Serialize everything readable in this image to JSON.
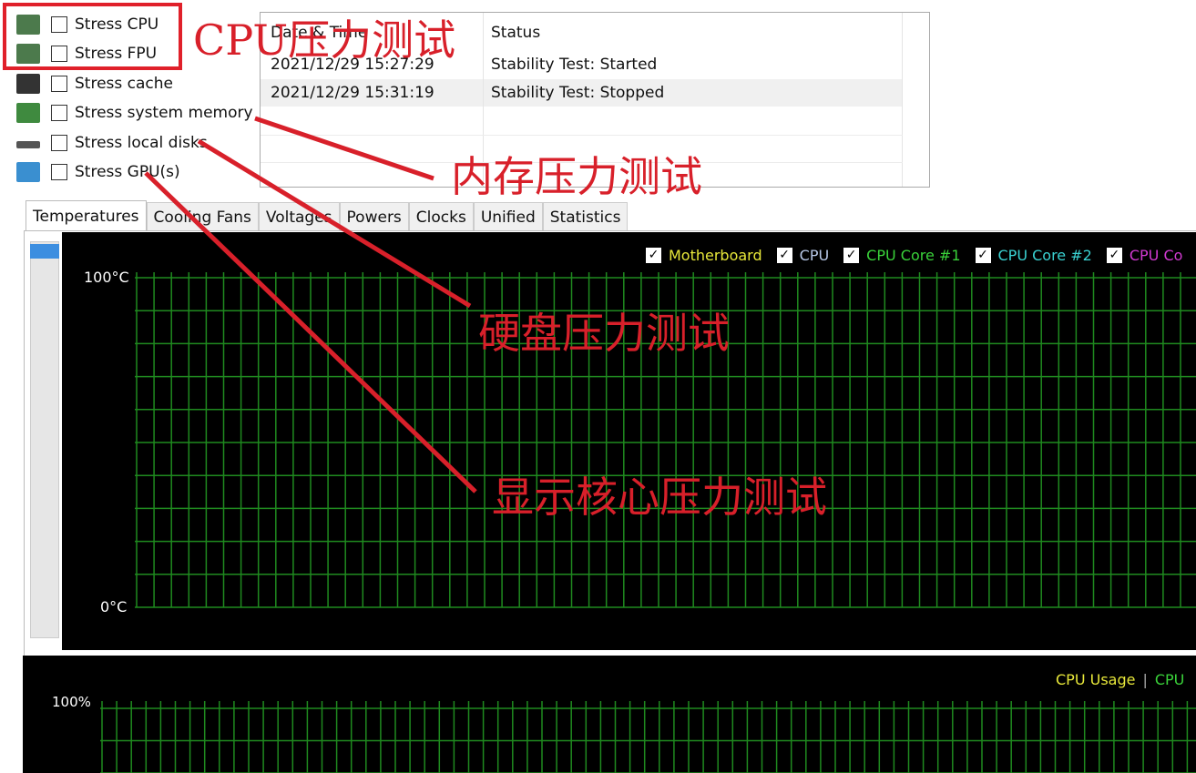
{
  "options": [
    {
      "label": "Stress CPU",
      "icon": "cpu-chip-icon",
      "checked": false
    },
    {
      "label": "Stress FPU",
      "icon": "fpu-chip-icon",
      "checked": false
    },
    {
      "label": "Stress cache",
      "icon": "cache-chip-icon",
      "checked": false
    },
    {
      "label": "Stress system memory",
      "icon": "memory-module-icon",
      "checked": false
    },
    {
      "label": "Stress local disks",
      "icon": "disk-drive-icon",
      "checked": false
    },
    {
      "label": "Stress GPU(s)",
      "icon": "gpu-card-icon",
      "checked": false
    }
  ],
  "log": {
    "headers": [
      "Date & Time",
      "Status"
    ],
    "rows": [
      [
        "2021/12/29 15:27:29",
        "Stability Test: Started"
      ],
      [
        "2021/12/29 15:31:19",
        "Stability Test: Stopped"
      ]
    ]
  },
  "tabs": [
    "Temperatures",
    "Cooling Fans",
    "Voltages",
    "Powers",
    "Clocks",
    "Unified",
    "Statistics"
  ],
  "active_tab": "Temperatures",
  "temp_chart": {
    "ymax_label": "100°C",
    "ymin_label": "0°C",
    "legend": [
      {
        "label": "Motherboard",
        "color": "#e8e83a"
      },
      {
        "label": "CPU",
        "color": "#b8c8e8"
      },
      {
        "label": "CPU Core #1",
        "color": "#3ad23a"
      },
      {
        "label": "CPU Core #2",
        "color": "#3ad2d2"
      },
      {
        "label": "CPU Co",
        "color": "#d23ad2"
      }
    ]
  },
  "usage_chart": {
    "ymax_label": "100%",
    "legend": [
      {
        "label": "CPU Usage",
        "color": "#e8e83a"
      },
      {
        "label": "CPU",
        "color": "#3ad23a"
      }
    ],
    "separator": "|"
  },
  "annotations": [
    "CPU压力测试",
    "内存压力测试",
    "硬盘压力测试",
    "显示核心压力测试"
  ],
  "colors": {
    "grid": "#1f8a1f",
    "annotation": "#d8202a",
    "scroll_thumb": "#3c8ee0"
  }
}
